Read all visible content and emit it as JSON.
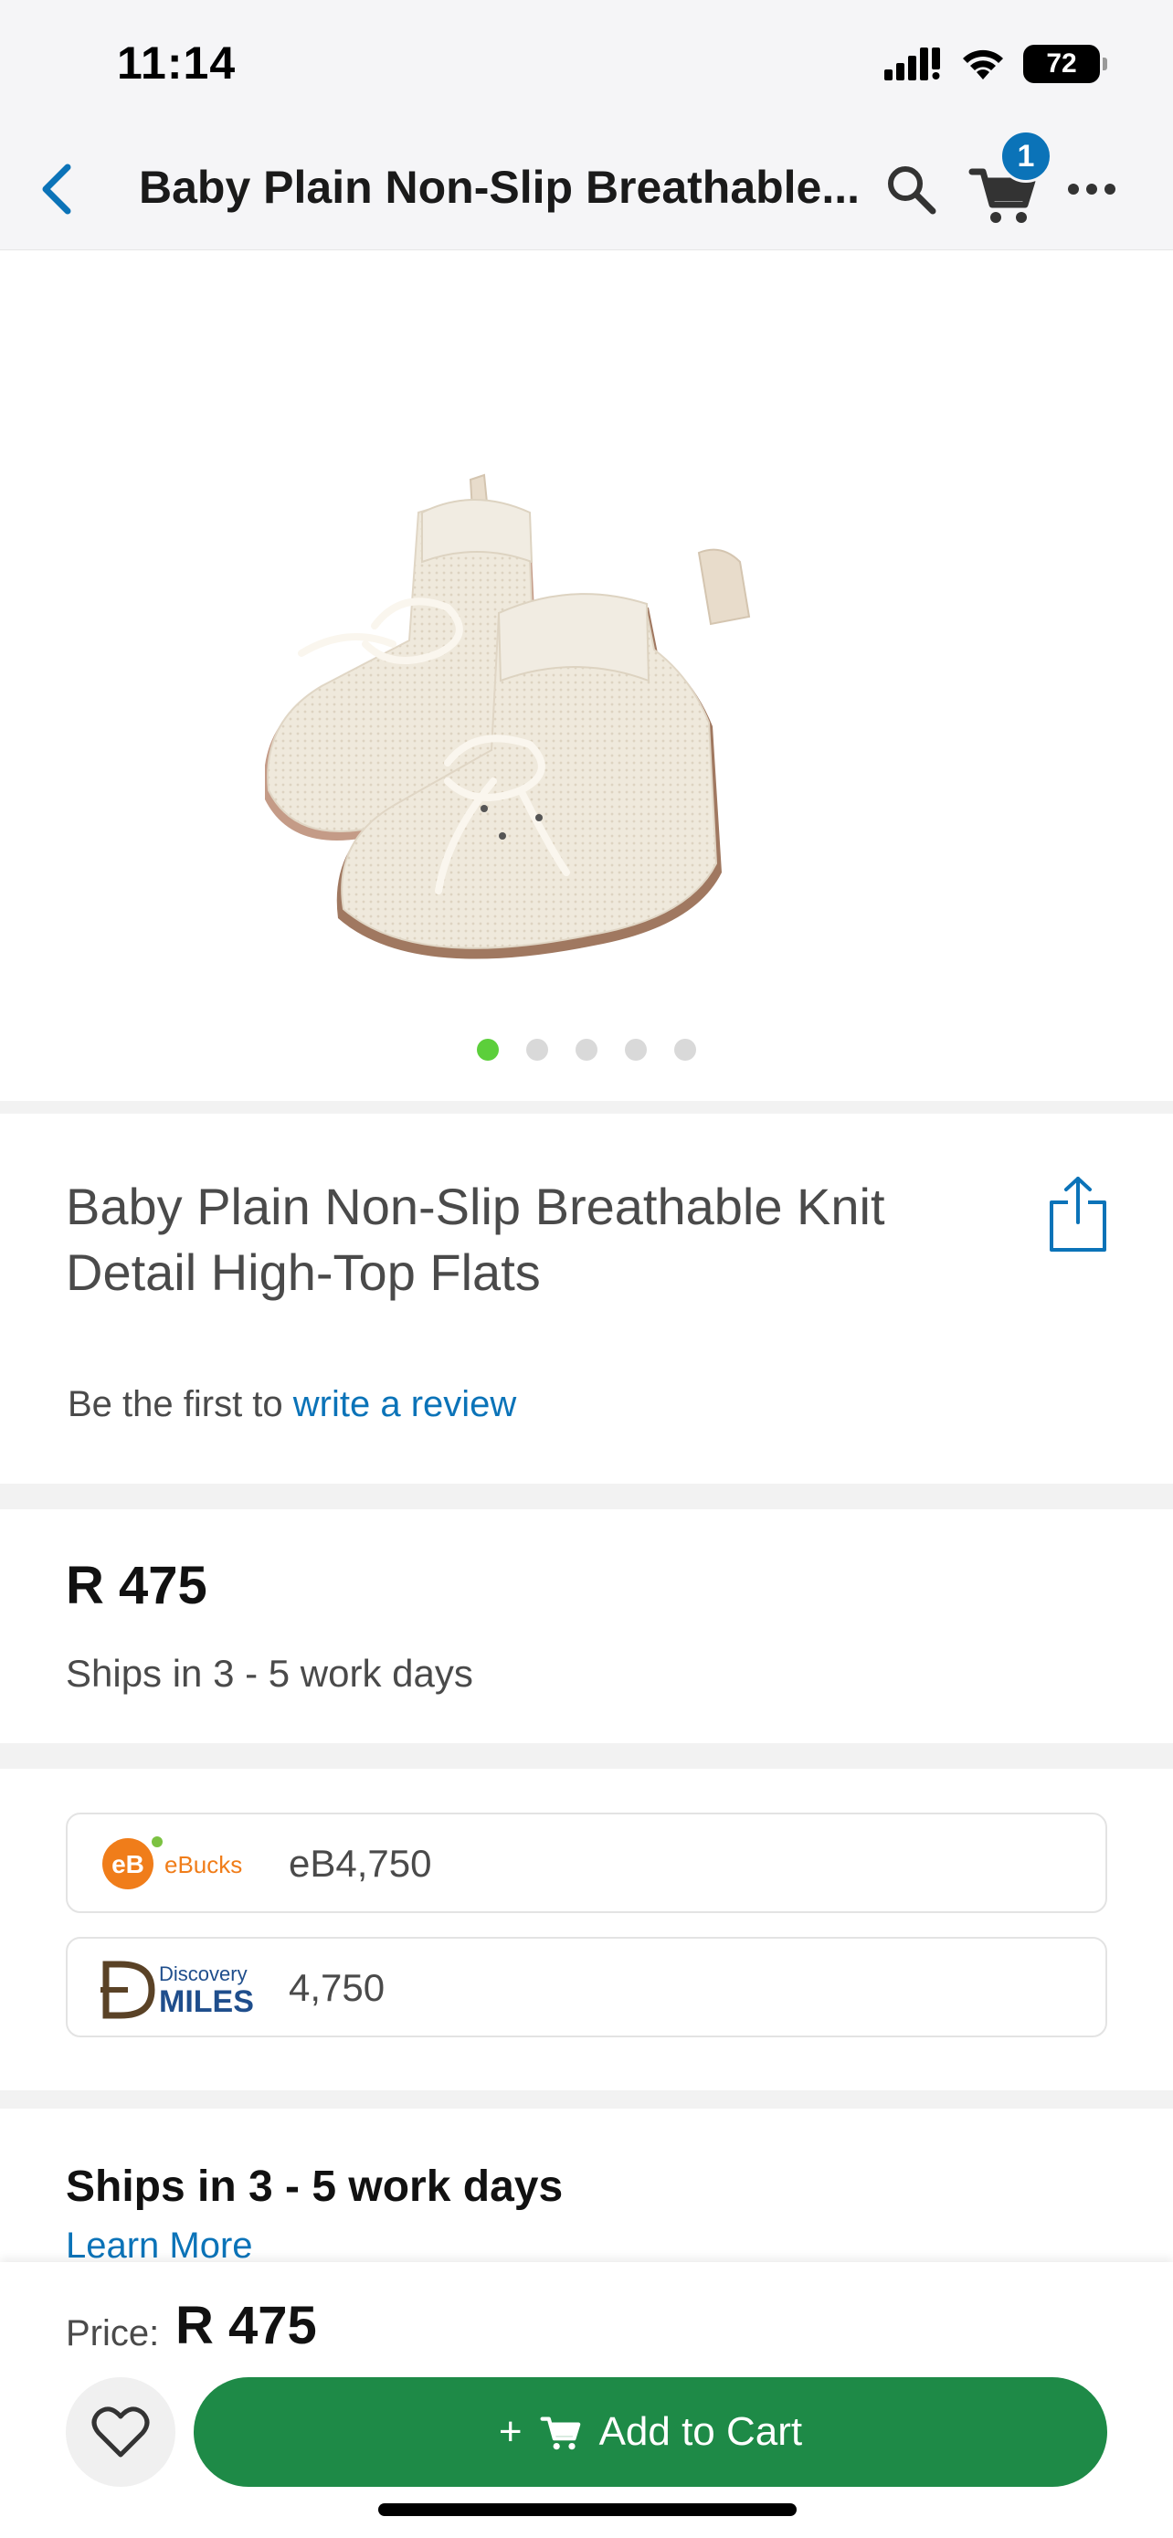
{
  "status_bar": {
    "time": "11:14",
    "battery": "72"
  },
  "nav": {
    "title": "Baby Plain Non-Slip Breathable...",
    "cart_count": "1"
  },
  "gallery": {
    "image_count": 5,
    "active_index": 0
  },
  "product": {
    "title": "Baby Plain Non-Slip Breathable Knit Detail High-Top Flats",
    "review_prefix": "Be the first to ",
    "review_link": "write a review"
  },
  "price": {
    "amount": "R 475",
    "shipping": "Ships in 3 - 5 work days"
  },
  "rewards": {
    "ebucks": {
      "logo_text": "eBucks",
      "logo_mark": "eB",
      "value": "eB4,750"
    },
    "discovery": {
      "logo_top": "Discovery",
      "logo_bottom": "MILES",
      "value": "4,750"
    }
  },
  "shipping": {
    "title": "Ships in 3 - 5 work days",
    "link": "Learn More"
  },
  "bottom_bar": {
    "price_label": "Price:",
    "price": "R 475",
    "add_to_cart": "Add to Cart"
  },
  "colors": {
    "accent_blue": "#0b73b8",
    "cart_green": "#1e8a47",
    "active_dot": "#5ccf3b"
  }
}
